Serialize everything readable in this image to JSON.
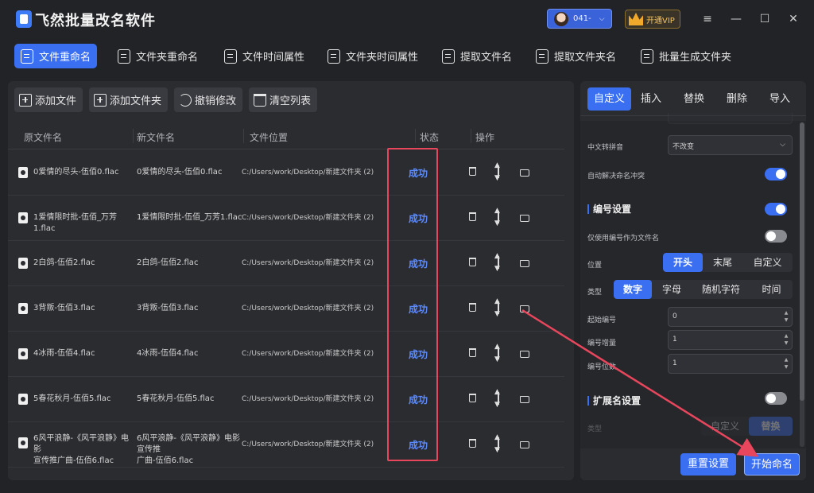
{
  "app": {
    "title": "飞然批量改名软件"
  },
  "header": {
    "user_label": "041-",
    "vip_label": "开通VIP",
    "window_controls": [
      "≡",
      "—",
      "☐",
      "✕"
    ]
  },
  "nav": {
    "tabs": [
      {
        "label": "文件重命名",
        "active": true
      },
      {
        "label": "文件夹重命名",
        "active": false
      },
      {
        "label": "文件时间属性",
        "active": false
      },
      {
        "label": "文件夹时间属性",
        "active": false
      },
      {
        "label": "提取文件名",
        "active": false
      },
      {
        "label": "提取文件夹名",
        "active": false
      },
      {
        "label": "批量生成文件夹",
        "active": false
      }
    ]
  },
  "toolbar": {
    "add_file": "添加文件",
    "add_folder": "添加文件夹",
    "undo": "撤销修改",
    "clear": "清空列表"
  },
  "table": {
    "columns": [
      "原文件名",
      "新文件名",
      "文件位置",
      "状态",
      "操作"
    ],
    "rows": [
      {
        "orig_line1": "0爱情的尽头-伍佰0.flac",
        "orig_line2": "",
        "new_line1": "0爱情的尽头-伍佰0.flac",
        "new_line2": "",
        "path": "C:/Users/work/Desktop/新建文件夹 (2)",
        "status": "成功"
      },
      {
        "orig_line1": "1爱情限时批-伍佰_万芳1.flac",
        "orig_line2": "",
        "new_line1": "1爱情限时批-伍佰_万芳1.flac",
        "new_line2": "",
        "path": "C:/Users/work/Desktop/新建文件夹 (2)",
        "status": "成功"
      },
      {
        "orig_line1": "2白鸽-伍佰2.flac",
        "orig_line2": "",
        "new_line1": "2白鸽-伍佰2.flac",
        "new_line2": "",
        "path": "C:/Users/work/Desktop/新建文件夹 (2)",
        "status": "成功"
      },
      {
        "orig_line1": "3背叛-伍佰3.flac",
        "orig_line2": "",
        "new_line1": "3背叛-伍佰3.flac",
        "new_line2": "",
        "path": "C:/Users/work/Desktop/新建文件夹 (2)",
        "status": "成功"
      },
      {
        "orig_line1": "4冰雨-伍佰4.flac",
        "orig_line2": "",
        "new_line1": "4冰雨-伍佰4.flac",
        "new_line2": "",
        "path": "C:/Users/work/Desktop/新建文件夹 (2)",
        "status": "成功"
      },
      {
        "orig_line1": "5春花秋月-伍佰5.flac",
        "orig_line2": "",
        "new_line1": "5春花秋月-伍佰5.flac",
        "new_line2": "",
        "path": "C:/Users/work/Desktop/新建文件夹 (2)",
        "status": "成功"
      },
      {
        "orig_line1": "6风平浪静-《风平浪静》电影",
        "orig_line2": "宣传推广曲-伍佰6.flac",
        "new_line1": "6风平浪静-《风平浪静》电影宣传推",
        "new_line2": "广曲-伍佰6.flac",
        "path": "C:/Users/work/Desktop/新建文件夹 (2)",
        "status": "成功"
      }
    ]
  },
  "right": {
    "tabs": [
      {
        "label": "自定义",
        "active": true
      },
      {
        "label": "插入",
        "active": false
      },
      {
        "label": "替换",
        "active": false
      },
      {
        "label": "删除",
        "active": false
      },
      {
        "label": "导入",
        "active": false
      }
    ],
    "pinyin_label": "中文转拼音",
    "pinyin_value": "不改变",
    "auto_conflict_label": "自动解决命名冲突",
    "numbering_title": "编号设置",
    "only_number_label": "仅使用编号作为文件名",
    "position_label": "位置",
    "position_options": [
      "开头",
      "末尾",
      "自定义"
    ],
    "type_label": "类型",
    "type_options": [
      "数字",
      "字母",
      "随机字符",
      "时间"
    ],
    "start_label": "起始编号",
    "start_value": "0",
    "step_label": "编号增量",
    "step_value": "1",
    "digits_label": "编号位数",
    "digits_value": "1",
    "ext_title": "扩展名设置",
    "ext_type_label": "类型",
    "ext_options": [
      "自定义",
      "替换"
    ],
    "reset_button": "重置设置",
    "start_button": "开始命名"
  }
}
